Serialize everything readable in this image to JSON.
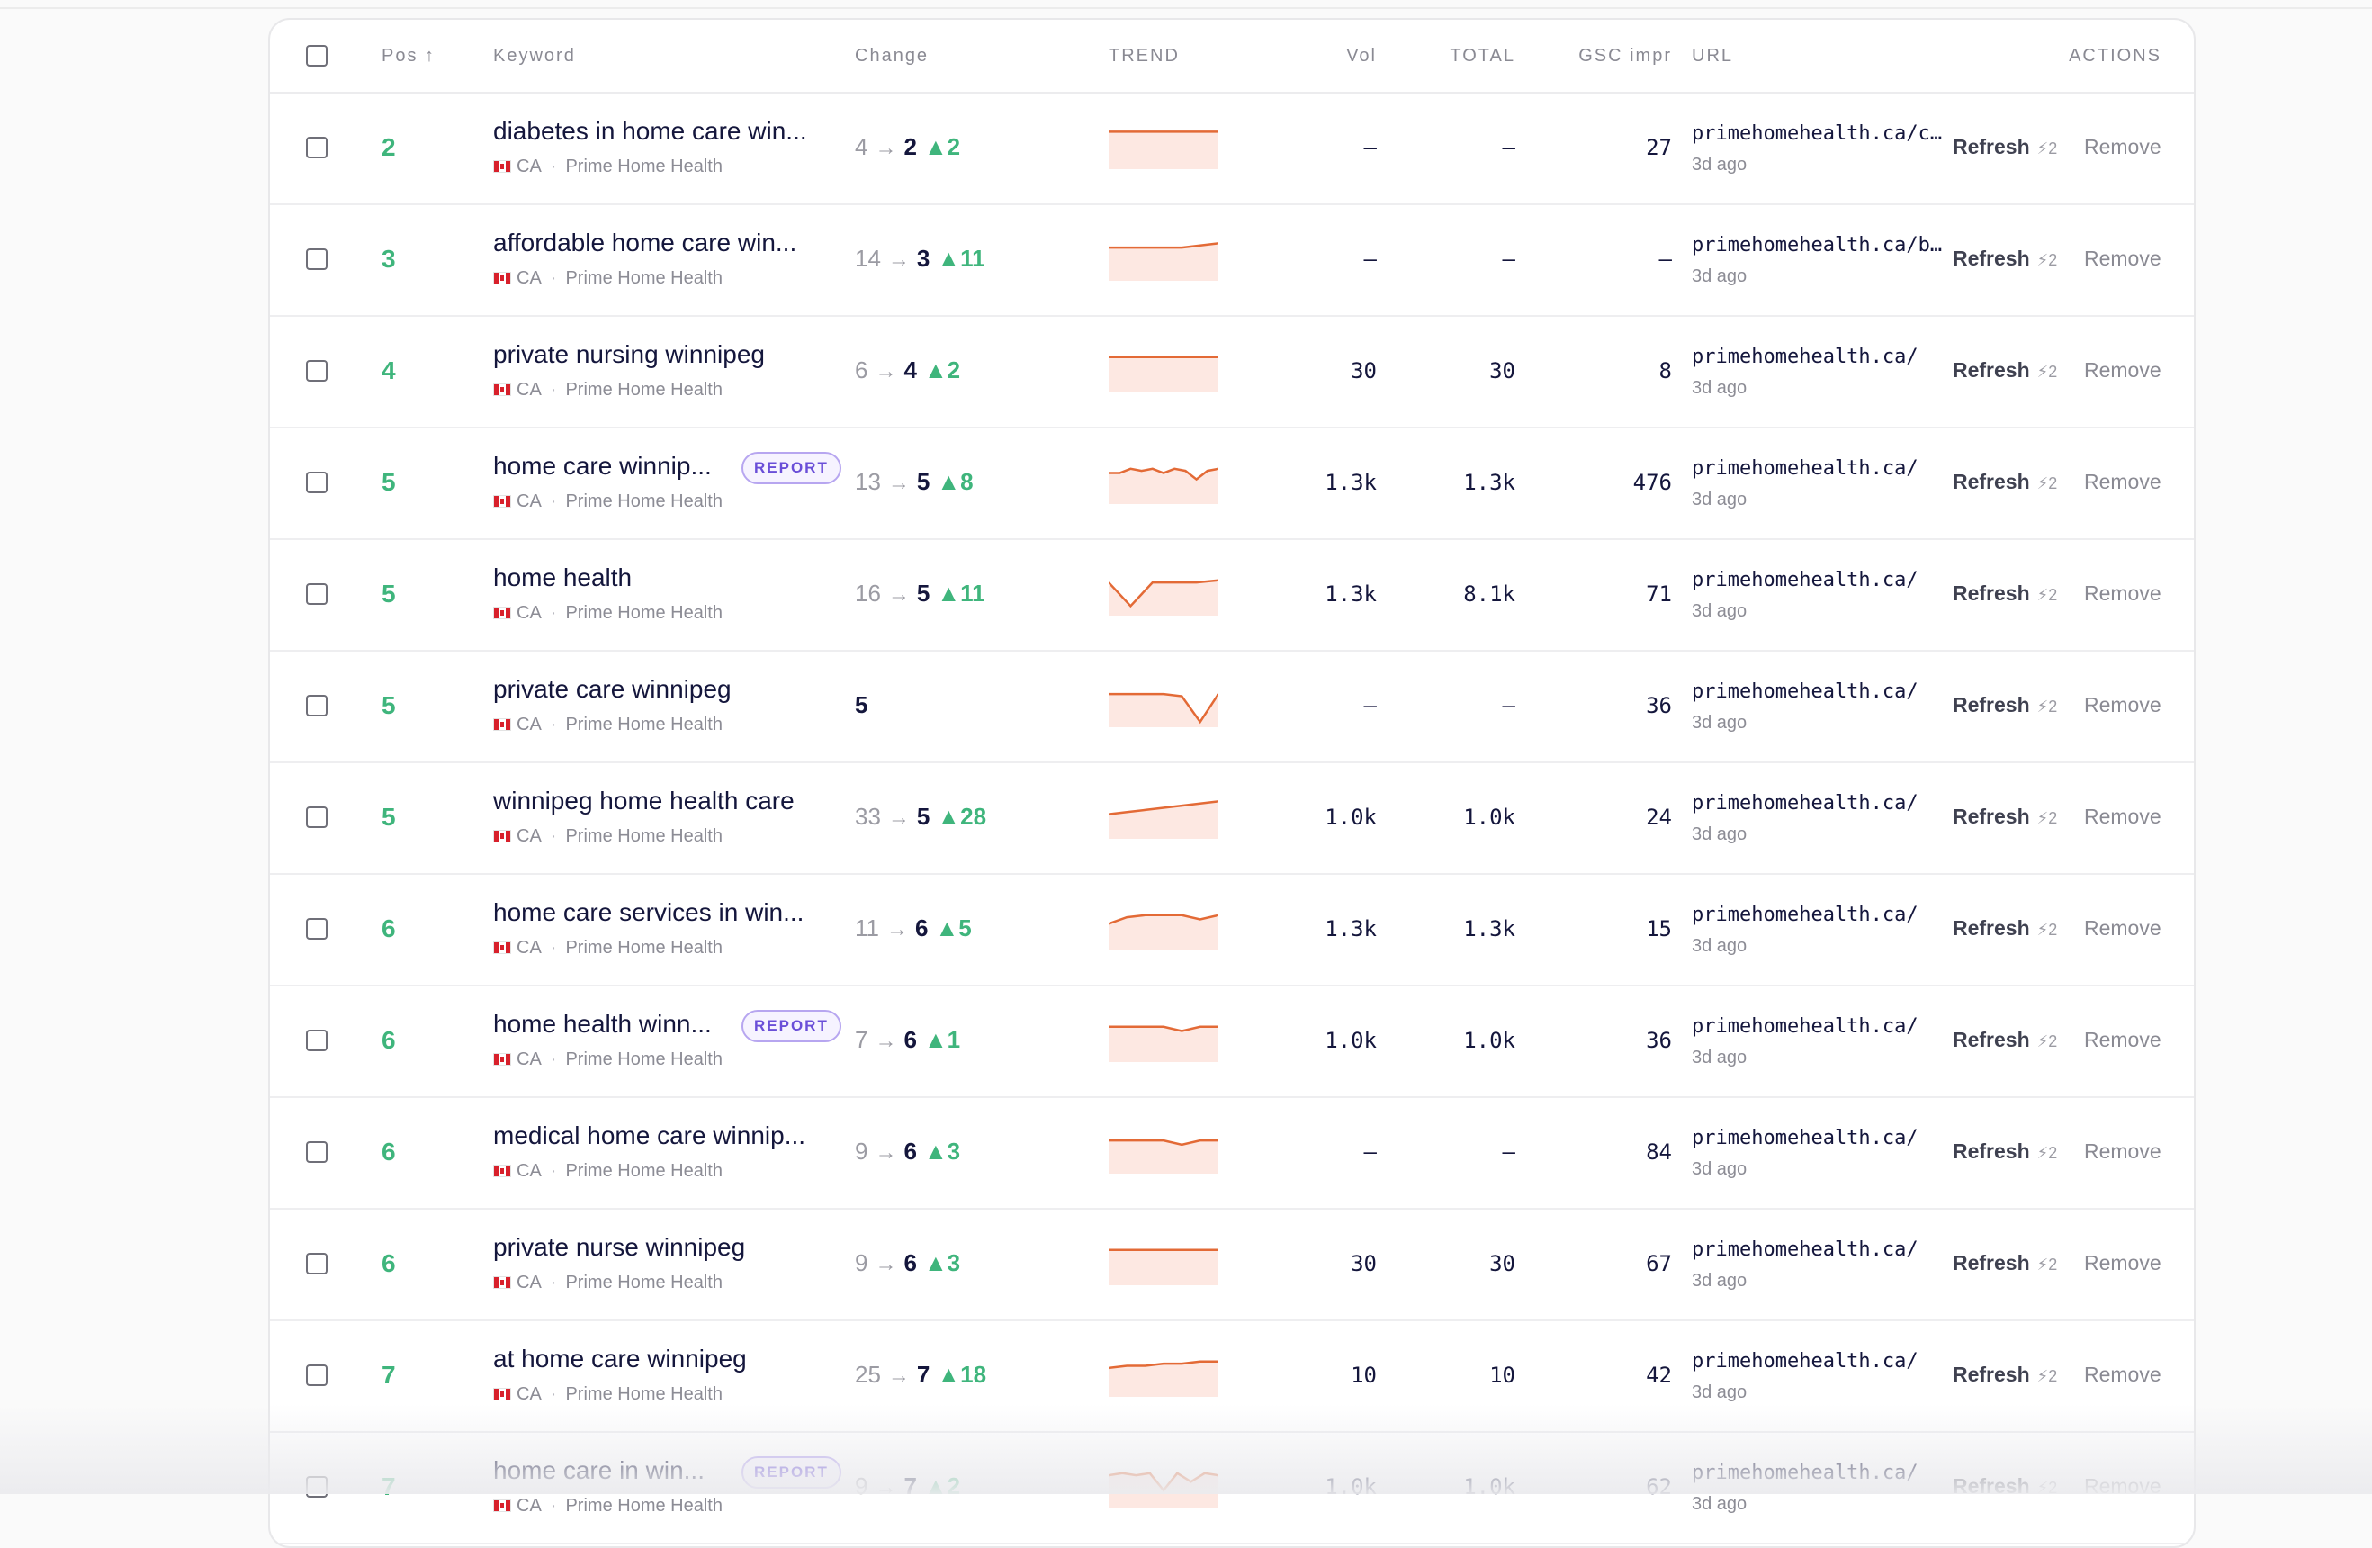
{
  "header": {
    "pos": "Pos",
    "keyword": "Keyword",
    "change": "Change",
    "trend": "TREND",
    "vol": "Vol",
    "total": "TOTAL",
    "gsc": "GSC impr",
    "url": "URL",
    "actions": "ACTIONS"
  },
  "icons": {
    "sort": "sort-ascending-icon",
    "flag": "canada-flag-icon",
    "arrow": "arrow-right-icon",
    "gain": "triangle-up-icon",
    "credit": "lightning-icon"
  },
  "colors": {
    "position": "#3fb57c",
    "gain": "#3fb57c",
    "trend_line": "#e36a36",
    "trend_fill": "#fde8e2",
    "badge": "#6a4fd8"
  },
  "labels": {
    "sort_arrow": "↑",
    "refresh": "Refresh",
    "remove": "Remove",
    "credit": "⚡2",
    "report": "REPORT",
    "sep": "·",
    "arrow": "→",
    "gain_prefix": "▲"
  },
  "rows": [
    {
      "pos": "2",
      "keyword": "diabetes in home care win...",
      "report": false,
      "country": "CA",
      "project": "Prime Home Health",
      "from": "4",
      "to": "2",
      "gain": "2",
      "trend": [
        3,
        3,
        3,
        3,
        3,
        3,
        3
      ],
      "vol": "—",
      "total": "—",
      "gsc": "27",
      "url": "primehomehealth.ca/co...",
      "ago": "3d ago"
    },
    {
      "pos": "3",
      "keyword": "affordable home care win...",
      "report": false,
      "country": "CA",
      "project": "Prime Home Health",
      "from": "14",
      "to": "3",
      "gain": "11",
      "trend": [
        5,
        5,
        5,
        5,
        5,
        4,
        3
      ],
      "vol": "—",
      "total": "—",
      "gsc": "—",
      "url": "primehomehealth.ca/bl...",
      "ago": "3d ago"
    },
    {
      "pos": "4",
      "keyword": "private nursing winnipeg",
      "report": false,
      "country": "CA",
      "project": "Prime Home Health",
      "from": "6",
      "to": "4",
      "gain": "2",
      "trend": [
        4,
        4,
        4,
        4,
        4,
        4,
        4
      ],
      "vol": "30",
      "total": "30",
      "gsc": "8",
      "url": "primehomehealth.ca/",
      "ago": "3d ago"
    },
    {
      "pos": "5",
      "keyword": "home care winnip...",
      "report": true,
      "country": "CA",
      "project": "Prime Home Health",
      "from": "13",
      "to": "5",
      "gain": "8",
      "trend": [
        6,
        6,
        4,
        5,
        4,
        6,
        4,
        5,
        9,
        5,
        4
      ],
      "vol": "1.3k",
      "total": "1.3k",
      "gsc": "476",
      "url": "primehomehealth.ca/",
      "ago": "3d ago"
    },
    {
      "pos": "5",
      "keyword": "home health",
      "report": false,
      "country": "CA",
      "project": "Prime Home Health",
      "from": "16",
      "to": "5",
      "gain": "11",
      "trend": [
        5,
        16,
        5,
        5,
        5,
        4
      ],
      "vol": "1.3k",
      "total": "8.1k",
      "gsc": "71",
      "url": "primehomehealth.ca/",
      "ago": "3d ago"
    },
    {
      "pos": "5",
      "keyword": "private care winnipeg",
      "report": false,
      "country": "CA",
      "project": "Prime Home Health",
      "from": "",
      "to": "5",
      "gain": "",
      "trend": [
        5,
        5,
        5,
        5,
        6,
        18,
        5
      ],
      "vol": "—",
      "total": "—",
      "gsc": "36",
      "url": "primehomehealth.ca/",
      "ago": "3d ago"
    },
    {
      "pos": "5",
      "keyword": "winnipeg home health care",
      "report": false,
      "country": "CA",
      "project": "Prime Home Health",
      "from": "33",
      "to": "5",
      "gain": "28",
      "trend": [
        9,
        8,
        7,
        6,
        5,
        4,
        3
      ],
      "vol": "1.0k",
      "total": "1.0k",
      "gsc": "24",
      "url": "primehomehealth.ca/",
      "ago": "3d ago"
    },
    {
      "pos": "6",
      "keyword": "home care services in win...",
      "report": false,
      "country": "CA",
      "project": "Prime Home Health",
      "from": "11",
      "to": "6",
      "gain": "5",
      "trend": [
        8,
        5,
        4,
        4,
        4,
        6,
        4
      ],
      "vol": "1.3k",
      "total": "1.3k",
      "gsc": "15",
      "url": "primehomehealth.ca/",
      "ago": "3d ago"
    },
    {
      "pos": "6",
      "keyword": "home health winn...",
      "report": true,
      "country": "CA",
      "project": "Prime Home Health",
      "from": "7",
      "to": "6",
      "gain": "1",
      "trend": [
        4,
        4,
        4,
        4,
        6,
        4,
        4
      ],
      "vol": "1.0k",
      "total": "1.0k",
      "gsc": "36",
      "url": "primehomehealth.ca/",
      "ago": "3d ago"
    },
    {
      "pos": "6",
      "keyword": "medical home care winnip...",
      "report": false,
      "country": "CA",
      "project": "Prime Home Health",
      "from": "9",
      "to": "6",
      "gain": "3",
      "trend": [
        5,
        5,
        5,
        5,
        7,
        5,
        5
      ],
      "vol": "—",
      "total": "—",
      "gsc": "84",
      "url": "primehomehealth.ca/",
      "ago": "3d ago"
    },
    {
      "pos": "6",
      "keyword": "private nurse winnipeg",
      "report": false,
      "country": "CA",
      "project": "Prime Home Health",
      "from": "9",
      "to": "6",
      "gain": "3",
      "trend": [
        4,
        4,
        4,
        4,
        4,
        4,
        4
      ],
      "vol": "30",
      "total": "30",
      "gsc": "67",
      "url": "primehomehealth.ca/",
      "ago": "3d ago"
    },
    {
      "pos": "7",
      "keyword": "at home care winnipeg",
      "report": false,
      "country": "CA",
      "project": "Prime Home Health",
      "from": "25",
      "to": "7",
      "gain": "18",
      "trend": [
        7,
        6,
        6,
        5,
        5,
        4,
        4
      ],
      "vol": "10",
      "total": "10",
      "gsc": "42",
      "url": "primehomehealth.ca/",
      "ago": "3d ago"
    },
    {
      "pos": "7",
      "keyword": "home care in win...",
      "report": true,
      "country": "CA",
      "project": "Prime Home Health",
      "from": "9",
      "to": "7",
      "gain": "2",
      "trend": [
        5,
        4,
        5,
        4,
        12,
        4,
        8,
        4,
        5
      ],
      "vol": "1.0k",
      "total": "1.0k",
      "gsc": "62",
      "url": "primehomehealth.ca/",
      "ago": "3d ago"
    }
  ]
}
